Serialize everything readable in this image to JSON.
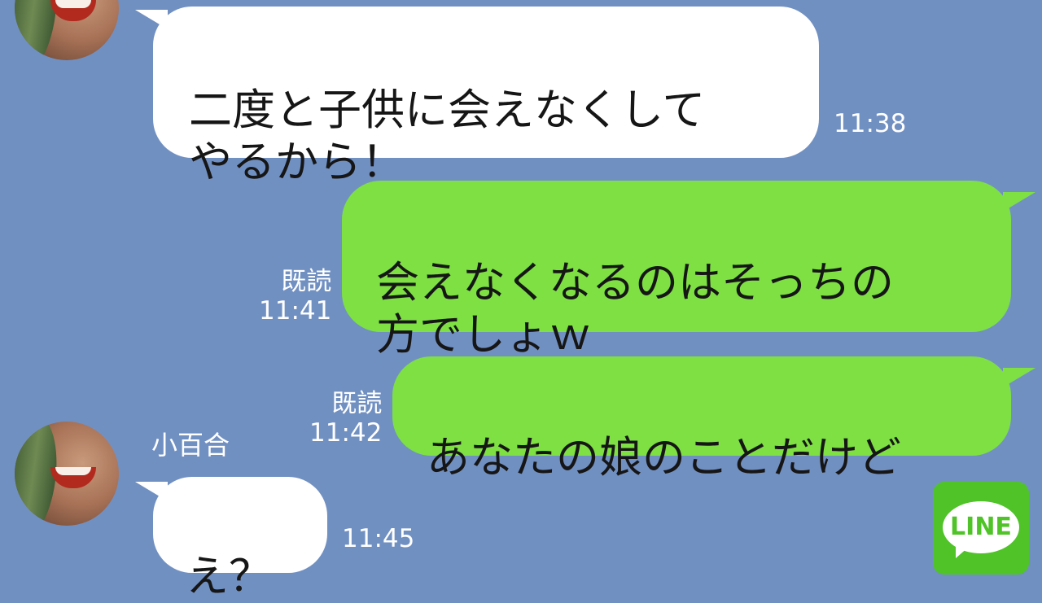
{
  "messages": [
    {
      "text": "二度と子供に会えなくして\nやるから！",
      "time": "11:38"
    },
    {
      "text": "会えなくなるのはそっちの\n方でしょｗ",
      "read": "既読",
      "time": "11:41"
    },
    {
      "text": "あなたの娘のことだけど",
      "read": "既読",
      "time": "11:42"
    },
    {
      "sender": "小百合",
      "text": "え？",
      "time": "11:45"
    }
  ],
  "badge": {
    "label": "LINE",
    "icon": "line-logo-icon"
  },
  "colors": {
    "background": "#7190c2",
    "incoming_bubble": "#ffffff",
    "outgoing_bubble": "#7ee043",
    "line_green": "#4fc328"
  }
}
